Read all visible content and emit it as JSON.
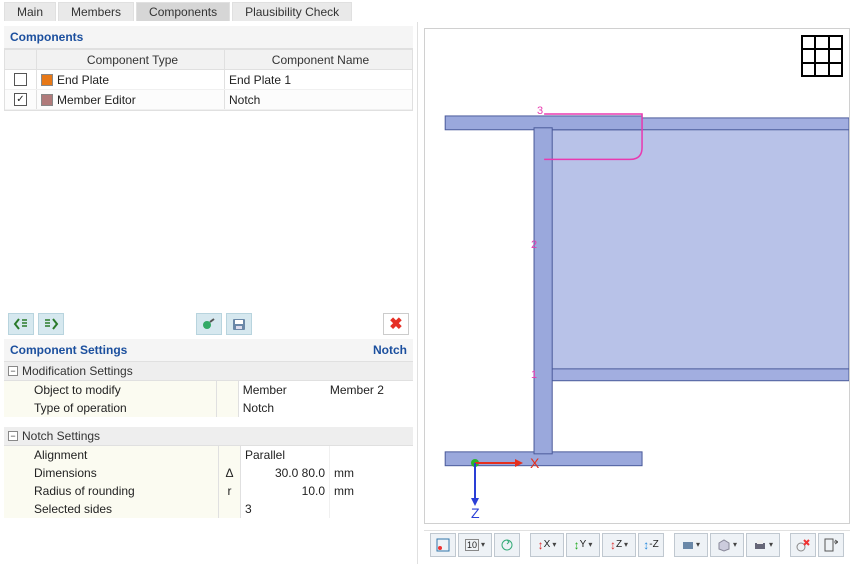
{
  "tabs": [
    "Main",
    "Members",
    "Components",
    "Plausibility Check"
  ],
  "activeTab": "Components",
  "componentsPanel": {
    "title": "Components",
    "headers": {
      "type": "Component Type",
      "name": "Component Name"
    },
    "rows": [
      {
        "checked": false,
        "color": "#e77817",
        "type": "End Plate",
        "name": "End Plate 1"
      },
      {
        "checked": true,
        "color": "#b07a7a",
        "type": "Member Editor",
        "name": "Notch"
      }
    ]
  },
  "settingsPanel": {
    "title": "Component Settings",
    "subtitle": "Notch",
    "groups": [
      {
        "name": "Modification Settings",
        "rows": [
          {
            "label": "Object to modify",
            "sym": "",
            "value": "Member",
            "value2": "Member 2",
            "unit": ""
          },
          {
            "label": "Type of operation",
            "sym": "",
            "value": "Notch",
            "value2": "",
            "unit": ""
          }
        ]
      },
      {
        "name": "Notch Settings",
        "rows": [
          {
            "label": "Alignment",
            "sym": "",
            "value": "Parallel",
            "value2": "",
            "unit": ""
          },
          {
            "label": "Dimensions",
            "sym": "Δ",
            "value": "",
            "value2": "30.0 80.0",
            "unit": "mm"
          },
          {
            "label": "Radius of rounding",
            "sym": "r",
            "value": "",
            "value2": "10.0",
            "unit": "mm"
          },
          {
            "label": "Selected sides",
            "sym": "",
            "value": "3",
            "value2": "",
            "unit": ""
          }
        ]
      }
    ]
  },
  "viewport": {
    "axis_x": "X",
    "axis_z": "Z",
    "markers": {
      "m1": "1",
      "m2": "2",
      "m3": "3"
    },
    "bottomToolbar": {
      "zoomLabel": "10"
    }
  }
}
